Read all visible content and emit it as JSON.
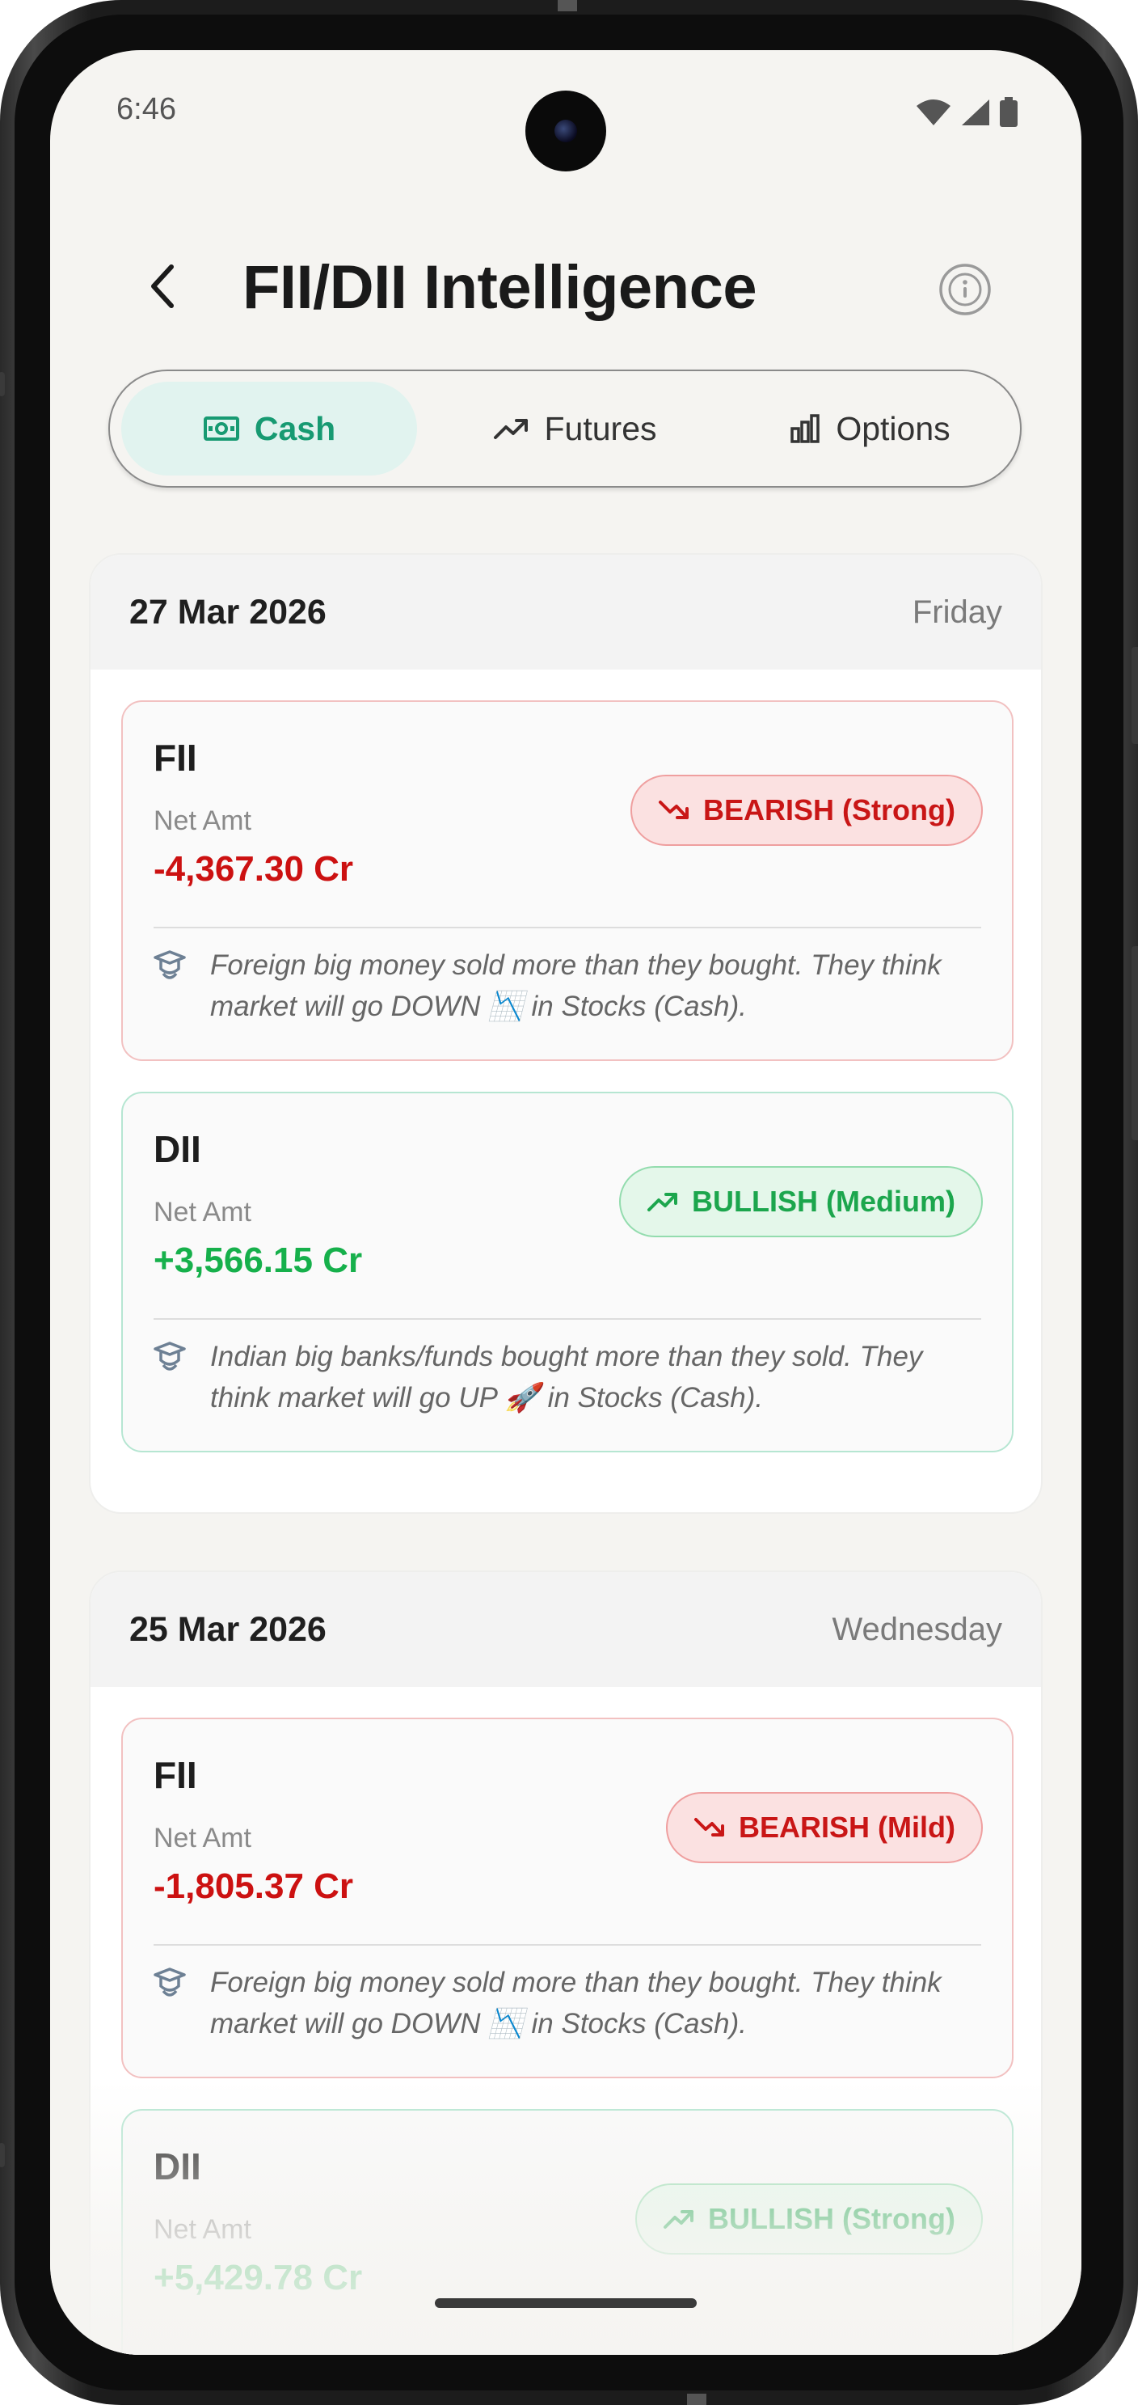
{
  "status_bar": {
    "time": "6:46"
  },
  "header": {
    "title": "FII/DII Intelligence"
  },
  "tabs": [
    {
      "label": "Cash",
      "active": true,
      "icon": "cash-icon"
    },
    {
      "label": "Futures",
      "active": false,
      "icon": "trending-up-icon"
    },
    {
      "label": "Options",
      "active": false,
      "icon": "bar-chart-icon"
    }
  ],
  "days": [
    {
      "date": "27 Mar 2026",
      "weekday": "Friday",
      "flows": [
        {
          "entity": "FII",
          "net_label": "Net Amt",
          "net_amount": "-4,367.30 Cr",
          "sentiment": "BEARISH (Strong)",
          "explanation": "Foreign big money sold more than they bought. They think market will go DOWN 📉 in Stocks (Cash)."
        },
        {
          "entity": "DII",
          "net_label": "Net Amt",
          "net_amount": "+3,566.15 Cr",
          "sentiment": "BULLISH (Medium)",
          "explanation": "Indian big banks/funds bought more than they sold. They think market will go UP 🚀 in Stocks (Cash)."
        }
      ]
    },
    {
      "date": "25 Mar 2026",
      "weekday": "Wednesday",
      "flows": [
        {
          "entity": "FII",
          "net_label": "Net Amt",
          "net_amount": "-1,805.37 Cr",
          "sentiment": "BEARISH (Mild)",
          "explanation": "Foreign big money sold more than they bought. They think market will go DOWN 📉 in Stocks (Cash)."
        },
        {
          "entity": "DII",
          "net_label": "Net Amt",
          "net_amount": "+5,429.78 Cr",
          "sentiment": "BULLISH (Strong)",
          "explanation": ""
        }
      ]
    }
  ],
  "colors": {
    "accent": "#179a72",
    "bearish": "#cc1111",
    "bullish": "#16b04b",
    "background": "#f5f4f1"
  }
}
